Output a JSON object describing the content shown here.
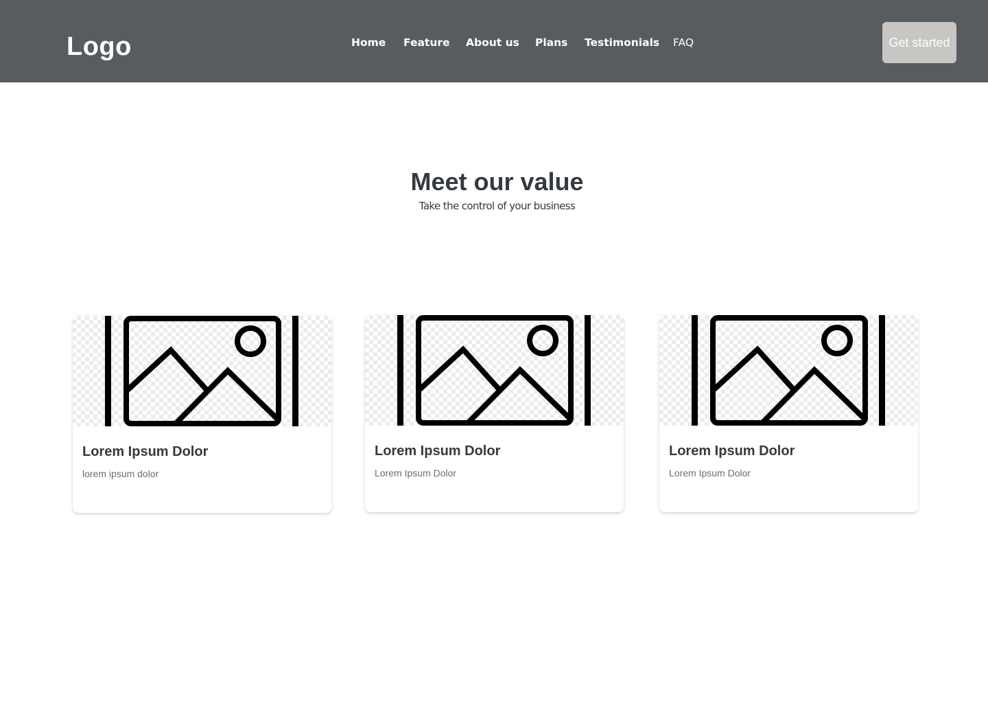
{
  "header": {
    "logo": "Logo",
    "nav": [
      "Home",
      "Feature",
      "About us",
      "Plans",
      "Testimonials",
      "FAQ"
    ],
    "cta_label": "Get started",
    "background": "#575c61",
    "cta_background": "#c7c6c3"
  },
  "section": {
    "title": "Meet our value",
    "subtitle": "Take the control of your business"
  },
  "cards": [
    {
      "image_icon": "image-placeholder-icon",
      "title": "Lorem Ipsum Dolor",
      "text": "lorem ipsum dolor"
    },
    {
      "image_icon": "image-placeholder-icon",
      "title": "Lorem Ipsum Dolor",
      "text": "Lorem Ipsum Dolor"
    },
    {
      "image_icon": "image-placeholder-icon",
      "title": "Lorem Ipsum Dolor",
      "text": "Lorem Ipsum Dolor"
    }
  ]
}
